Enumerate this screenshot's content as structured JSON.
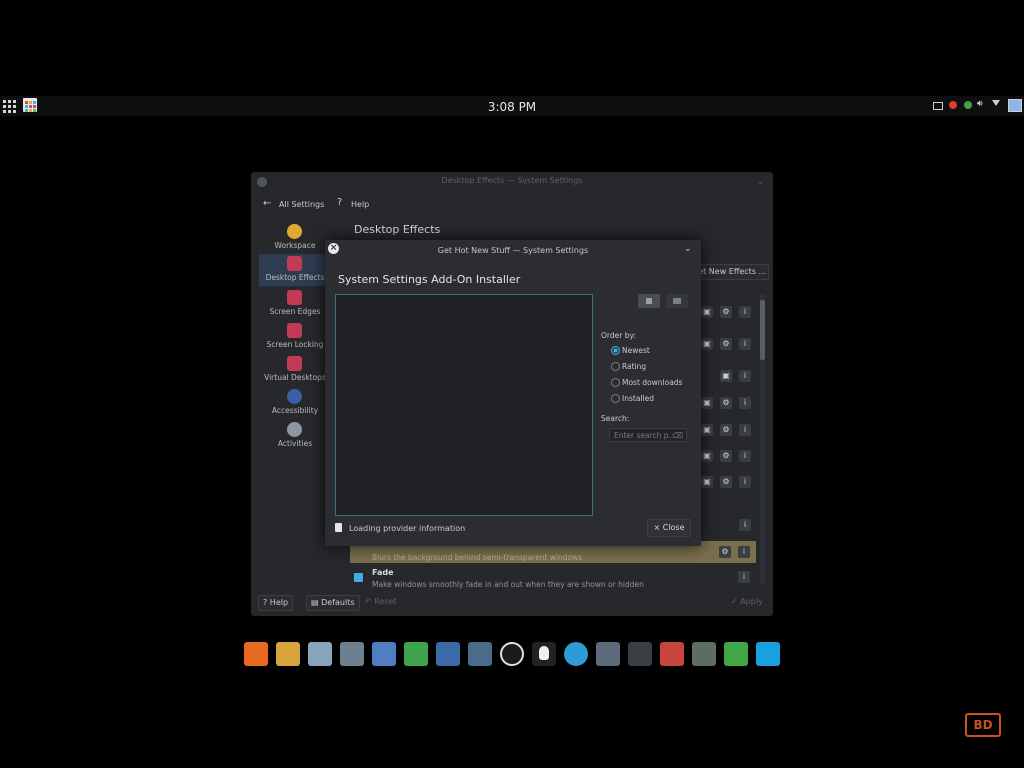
{
  "panel": {
    "clock": "3:08 PM"
  },
  "settings_window": {
    "title": "Desktop Effects — System Settings",
    "nav_back": "All Settings",
    "nav_help": "Help",
    "page_title": "Desktop Effects",
    "get_new_effects": "Get New Effects ...",
    "sidebar": [
      {
        "label": "Workspace"
      },
      {
        "label": "Desktop Effects"
      },
      {
        "label": "Screen Edges"
      },
      {
        "label": "Screen Locking"
      },
      {
        "label": "Virtual Desktops"
      },
      {
        "label": "Accessibility"
      },
      {
        "label": "Activities"
      }
    ],
    "effects": {
      "blur_description": "Blurs the background behind semi-transparent windows",
      "fade_name": "Fade",
      "fade_description": "Make windows smoothly fade in and out when they are shown or hidden"
    },
    "bottom": {
      "help": "Help",
      "defaults": "Defaults",
      "reset": "Reset",
      "apply": "Apply"
    }
  },
  "dialog": {
    "title": "Get Hot New Stuff — System Settings",
    "heading": "System Settings Add-On Installer",
    "order_by_label": "Order by:",
    "order_options": [
      "Newest",
      "Rating",
      "Most downloads",
      "Installed"
    ],
    "order_selected": "Newest",
    "search_label": "Search:",
    "search_placeholder": "Enter search p...",
    "status": "Loading provider information",
    "close": "Close"
  },
  "colors": {
    "accent": "#3daee9",
    "effect_icon": "#c23a55",
    "highlight_row": "#7a6f4d"
  },
  "watermark": "BD"
}
